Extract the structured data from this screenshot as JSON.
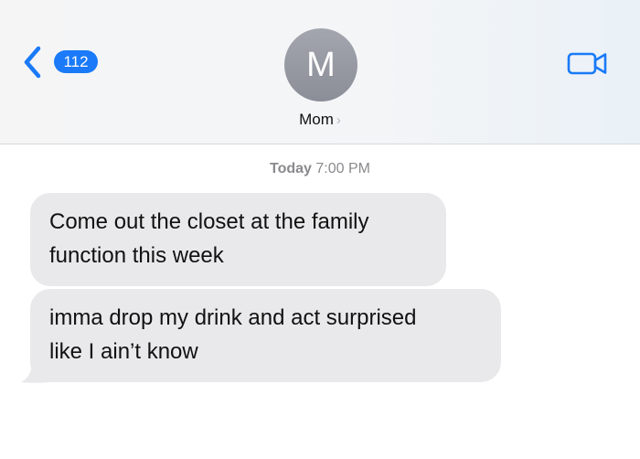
{
  "header": {
    "back_badge_count": "112",
    "avatar_initial": "M",
    "contact_name": "Mom",
    "contact_chevron": "›",
    "icons": {
      "back": "chevron-left-icon",
      "video": "video-camera-icon"
    },
    "accent_color": "#1a7af8"
  },
  "conversation": {
    "timestamp_day": "Today",
    "timestamp_time": "7:00 PM",
    "messages": [
      {
        "direction": "incoming",
        "lines": [
          "Come out the closet at the family",
          "function this week"
        ]
      },
      {
        "direction": "incoming",
        "lines": [
          "imma drop my drink and act surprised",
          "like I ain’t know"
        ]
      }
    ],
    "bubble_color": "#e9e9eb"
  }
}
